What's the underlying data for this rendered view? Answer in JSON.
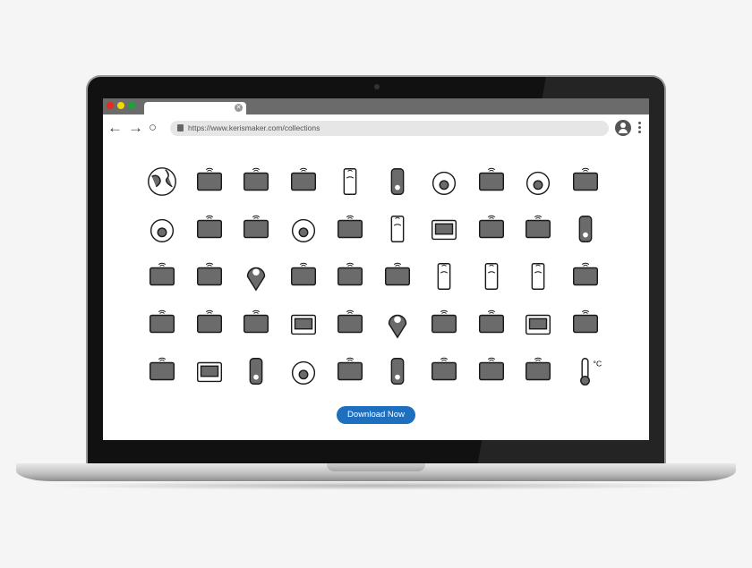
{
  "browser": {
    "window_controls": [
      {
        "name": "close",
        "color": "#e8291c"
      },
      {
        "name": "minimize",
        "color": "#f5d800"
      },
      {
        "name": "maximize",
        "color": "#1aa33a"
      }
    ],
    "url": "https://www.kerismaker.com/collections"
  },
  "icons": [
    "globe",
    "server-rack-wifi",
    "wifi-router",
    "smart-car",
    "smartphone-wifi",
    "remote-control",
    "smart-bulb",
    "radio-tower",
    "speedometer",
    "cloud-network",
    "security-camera",
    "air-conditioner",
    "vr-headset",
    "smart-lock",
    "drone",
    "phone-doorbell",
    "smart-tv",
    "smart-cart",
    "satellite",
    "nfc-card",
    "microchip",
    "camera-wifi",
    "location-pin",
    "credit-card",
    "solar-panel",
    "smart-speaker",
    "phone-scan",
    "door-lock-phone",
    "car-phone",
    "smartwatch",
    "radiator",
    "printer",
    "headphones-wifi",
    "smart-safe",
    "game-controller",
    "smart-home",
    "smart-fridge-display",
    "game-console-remotes",
    "desktop-computer",
    "smart-water-tap",
    "smart-plant-house",
    "smart-board",
    "refrigerator",
    "washing-machine",
    "wallet",
    "computer-mouse",
    "smart-workstation",
    "coffee-machine",
    "robot-arm",
    "thermometer"
  ],
  "icon_colors": {
    "fill": "#6b6b6b",
    "stroke": "#1a1a1a"
  },
  "download_button": {
    "label": "Download Now",
    "color": "#1f6fbf"
  }
}
